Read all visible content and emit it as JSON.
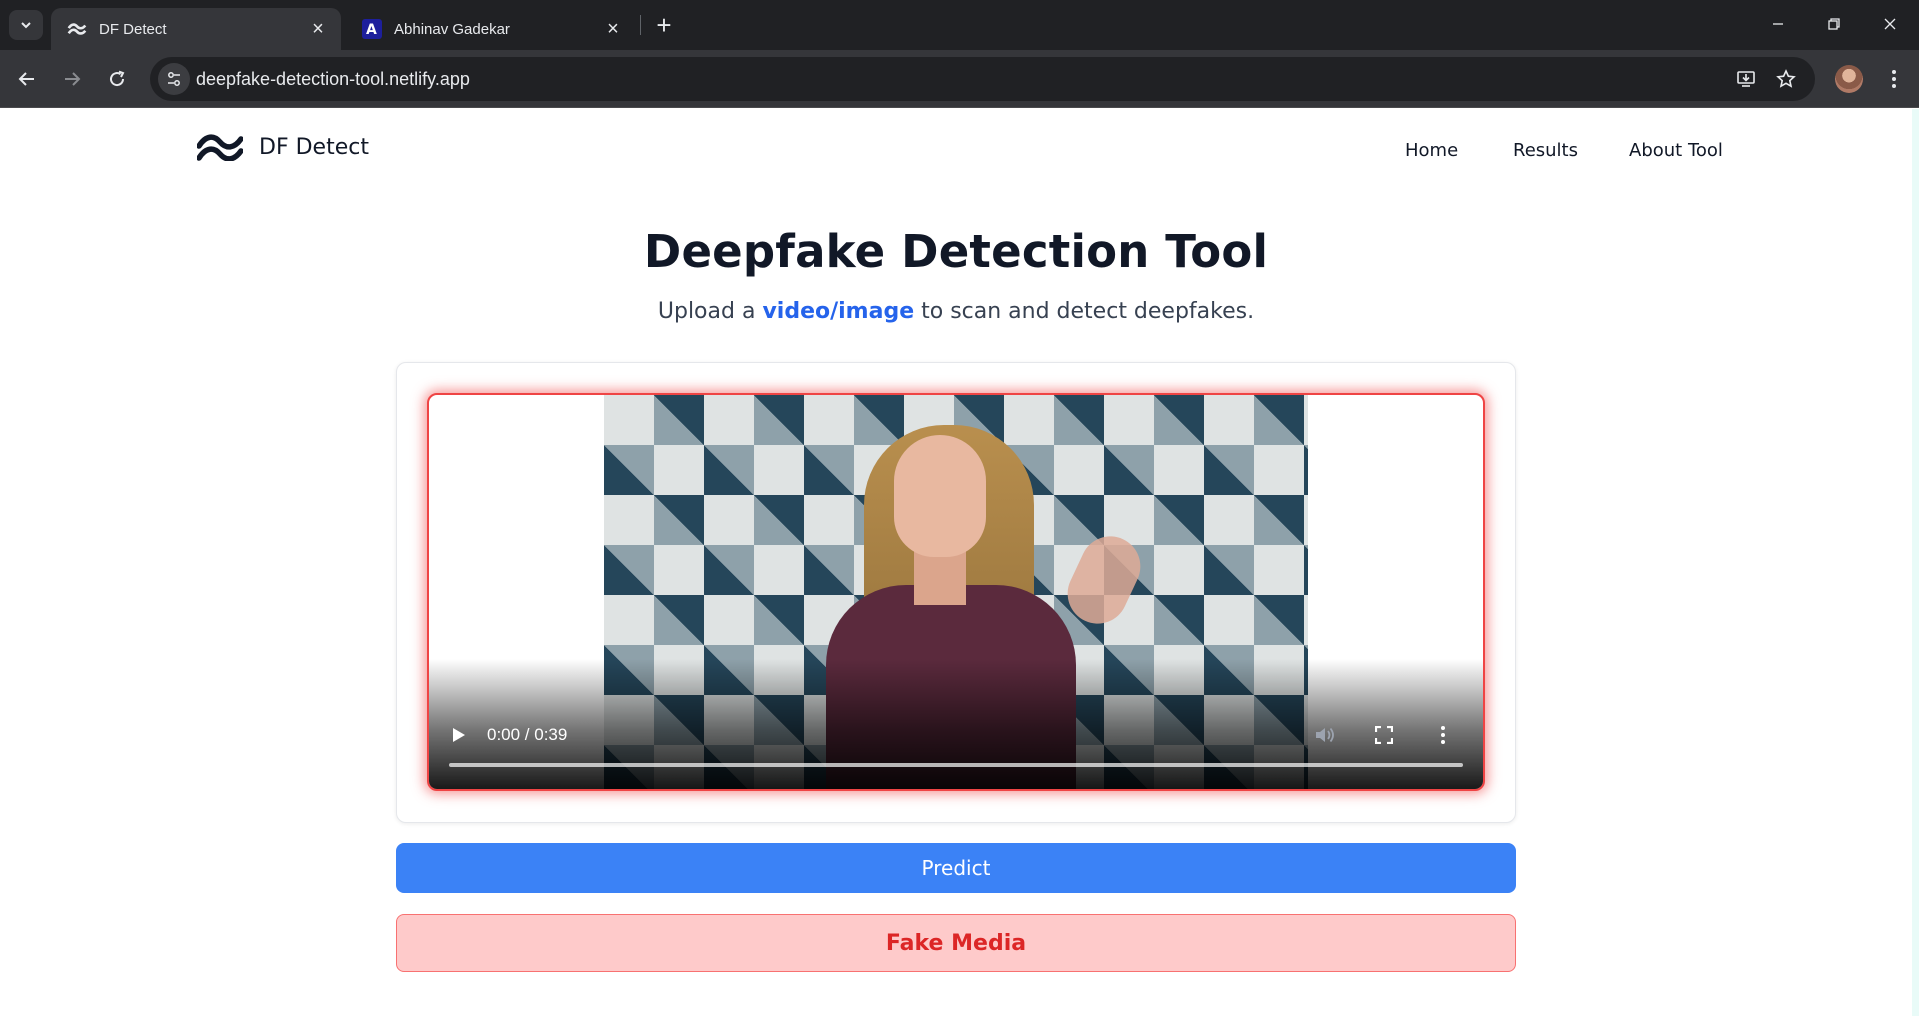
{
  "browser": {
    "tabs": [
      {
        "title": "DF Detect",
        "favicon": "df-detect-logo-icon",
        "active": true
      },
      {
        "title": "Abhinav Gadekar",
        "favicon": "portfolio-logo-icon",
        "active": false
      }
    ],
    "url": "deepfake-detection-tool.netlify.app"
  },
  "nav": {
    "brand": "DF Detect",
    "links": [
      "Home",
      "Results",
      "About Tool"
    ]
  },
  "hero": {
    "title": "Deepfake Detection Tool",
    "subtitle_before": "Upload a ",
    "subtitle_link": "video/image",
    "subtitle_after": " to scan and detect deepfakes."
  },
  "video": {
    "time": "0:00 / 0:39",
    "progress": 0.0,
    "border_color": "#ef4444"
  },
  "actions": {
    "predict_label": "Predict",
    "result_label": "Fake Media"
  },
  "colors": {
    "accent": "#3b82f6",
    "result_bg": "#fecaca",
    "result_text": "#dc2626"
  }
}
